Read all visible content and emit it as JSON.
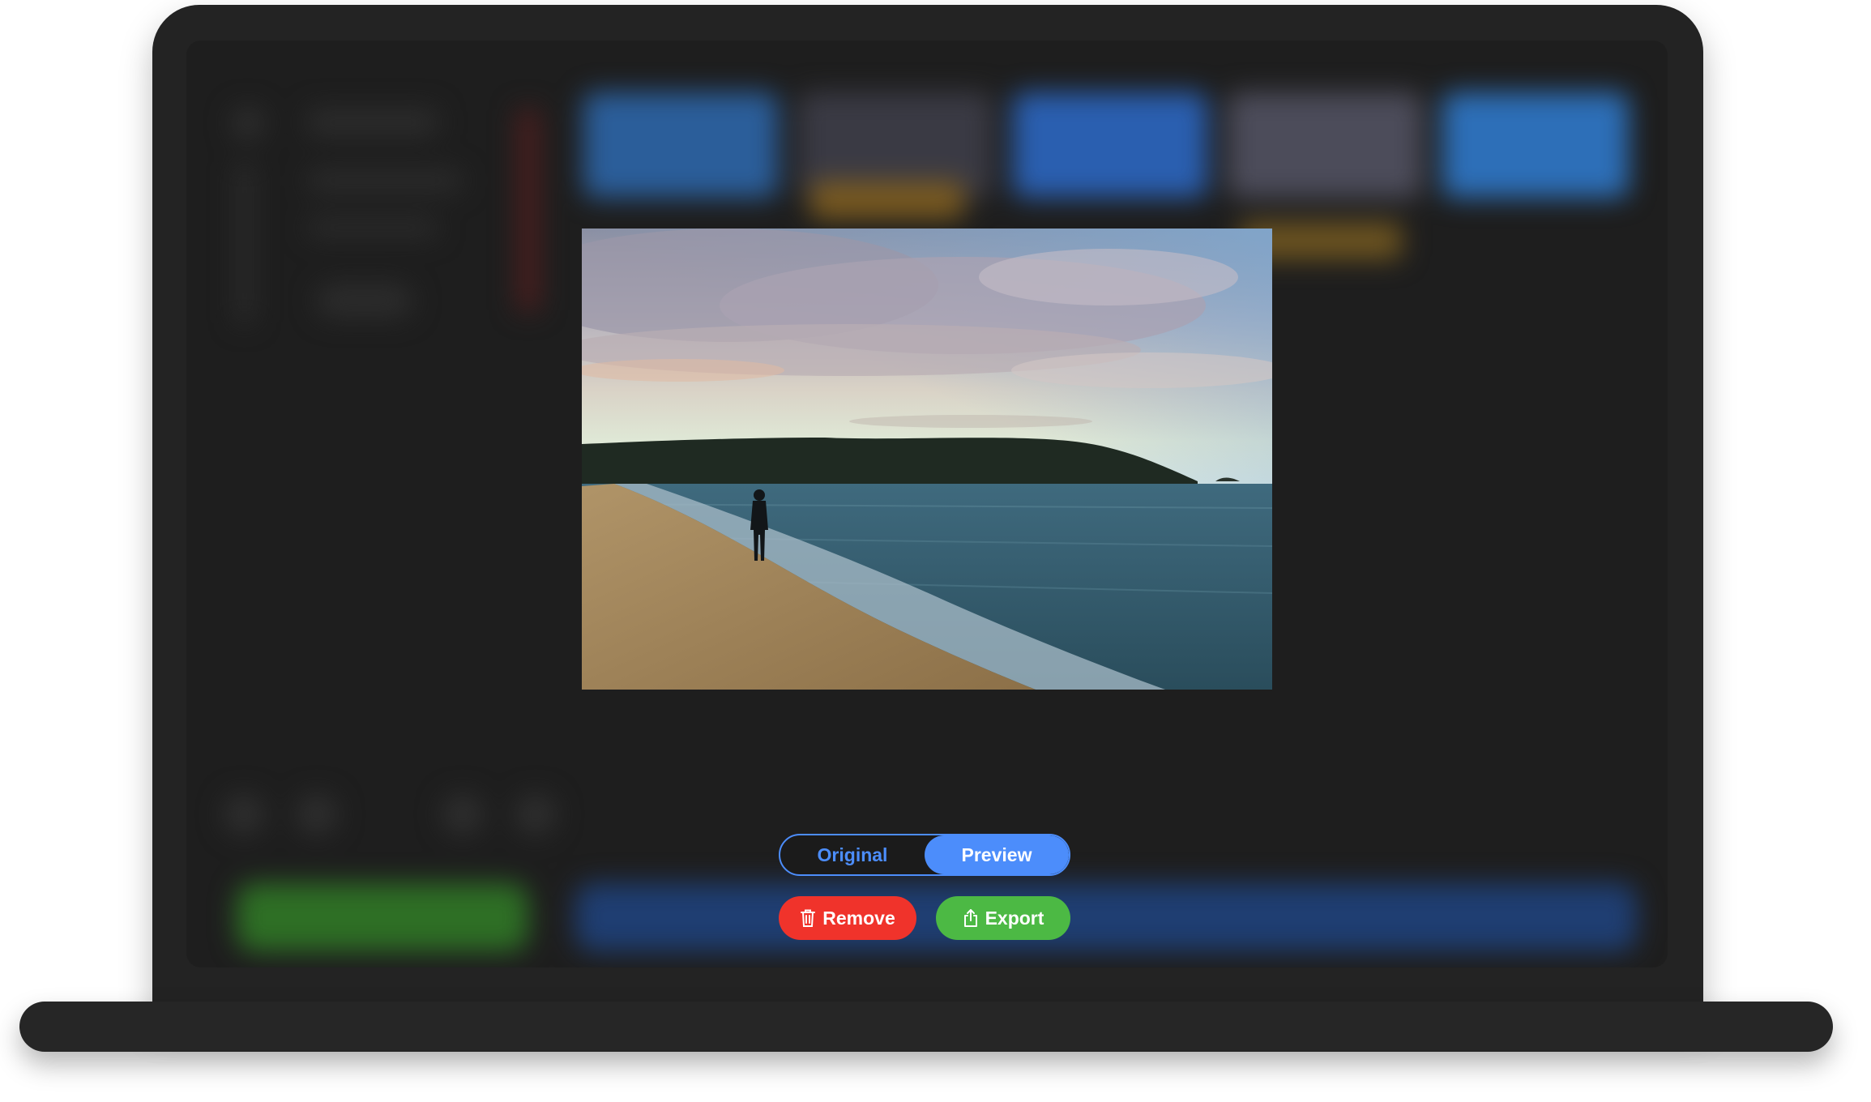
{
  "preview_toggle": {
    "options": [
      "Original",
      "Preview"
    ],
    "selected": "Preview"
  },
  "actions": {
    "remove_label": "Remove",
    "export_label": "Export"
  },
  "icons": {
    "remove": "trash-icon",
    "export": "share-icon"
  },
  "colors": {
    "accent_blue": "#4c8dfb",
    "remove_red": "#f0332b",
    "export_green": "#4cb944",
    "screen_bg": "#1e1e1e",
    "frame": "#232323"
  }
}
